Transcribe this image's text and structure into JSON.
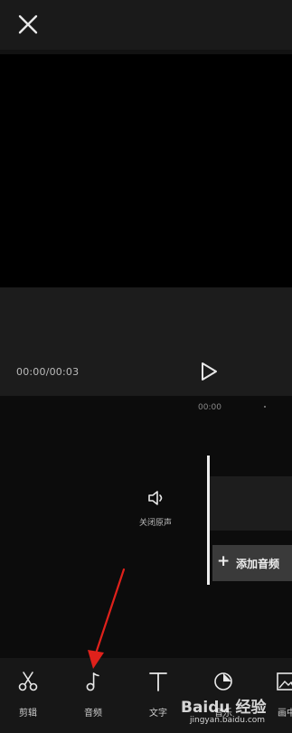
{
  "player": {
    "timecode": "00:00/00:03"
  },
  "timeline": {
    "ruler_time": "00:00",
    "mute_label": "关闭原声",
    "add_audio_plus": "+",
    "add_audio_label": "添加音频"
  },
  "toolbar": {
    "items": [
      {
        "label": "剪辑",
        "icon": "scissors-icon"
      },
      {
        "label": "音频",
        "icon": "music-note-icon"
      },
      {
        "label": "文字",
        "icon": "text-icon"
      },
      {
        "label": "音乐",
        "icon": "sticker-icon"
      },
      {
        "label": "画中",
        "icon": "picture-in-picture-icon"
      }
    ]
  },
  "watermark": {
    "logo": "Baidu 经验",
    "url": "jingyan.baidu.com"
  },
  "annotation": {
    "color": "#e0211b"
  }
}
